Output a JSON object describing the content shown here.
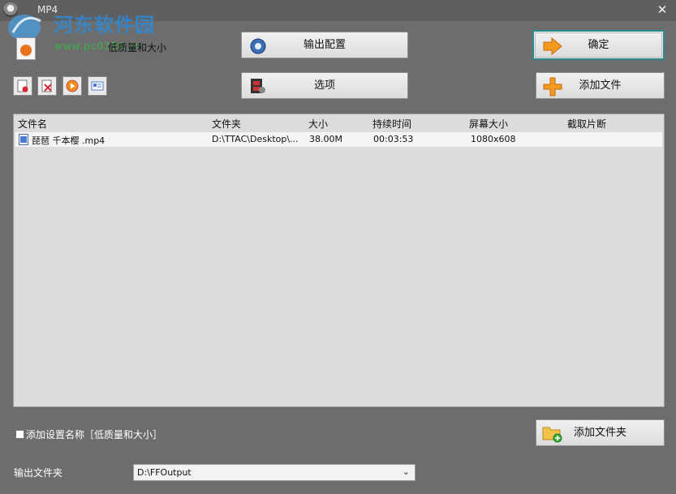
{
  "window": {
    "title": "MP4",
    "close_glyph": "✕"
  },
  "watermark": {
    "text": "河东软件园",
    "url": "www.pc0359.cn"
  },
  "profile": {
    "name": "低质量和大小",
    "icon": "mp4-profile-icon"
  },
  "toolbar_small": [
    {
      "name": "remove-file-icon"
    },
    {
      "name": "clear-list-icon"
    },
    {
      "name": "play-icon"
    },
    {
      "name": "file-info-icon"
    }
  ],
  "buttons": {
    "output_config": "输出配置",
    "options": "选项",
    "ok": "确定",
    "add_file": "添加文件",
    "add_folder": "添加文件夹"
  },
  "file_list": {
    "columns": [
      "文件名",
      "文件夹",
      "大小",
      "持续时间",
      "屏幕大小",
      "截取片断"
    ],
    "rows": [
      {
        "name": "琵琶 千本樱 .mp4",
        "folder": "D:\\TTAC\\Desktop\\...",
        "size": "38.00M",
        "duration": "00:03:53",
        "screen": "1080x608",
        "clip": ""
      }
    ]
  },
  "options": {
    "add_setting_name_label": "添加设置名称［低质量和大小］",
    "add_setting_name_checked": false
  },
  "output": {
    "label": "输出文件夹",
    "folder": "D:\\FFOutput"
  },
  "colors": {
    "background": "#6d6d6d",
    "list_bg": "#dcdcdc",
    "ok_border": "#2a8c8c",
    "accent_orange": "#f39a1e"
  }
}
